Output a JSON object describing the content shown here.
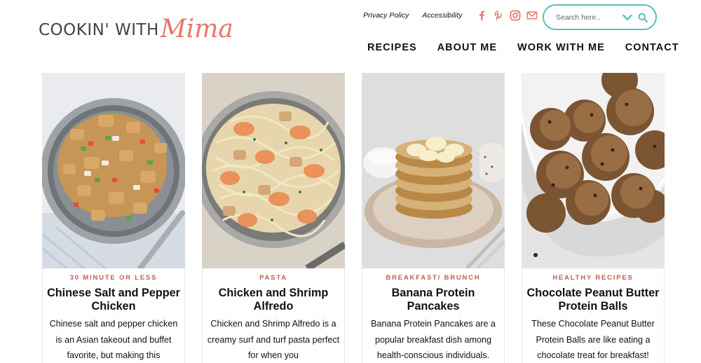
{
  "logo": {
    "text": "COOKIN' WITH",
    "script": "Mima"
  },
  "utility_links": {
    "privacy": "Privacy Policy",
    "accessibility": "Accessibility"
  },
  "social": [
    "facebook-icon",
    "pinterest-icon",
    "instagram-icon",
    "email-icon"
  ],
  "search": {
    "placeholder": "Search here.."
  },
  "nav": {
    "recipes": "RECIPES",
    "about": "ABOUT ME",
    "work": "WORK WITH ME",
    "contact": "CONTACT"
  },
  "colors": {
    "accent_teal": "#5bbfb9",
    "brand_coral": "#e8766b",
    "category_red": "#c45a4f"
  },
  "cards": [
    {
      "category": "30 MINUTE OR LESS",
      "title": "Chinese Salt and Pepper Chicken",
      "description": "Chinese salt and pepper chicken is an Asian takeout and buffet favorite, but making this"
    },
    {
      "category": "PASTA",
      "title": "Chicken and Shrimp Alfredo",
      "description": "Chicken and Shrimp Alfredo is a creamy surf and turf pasta perfect for when you"
    },
    {
      "category": "BREAKFAST/ BRUNCH",
      "title": "Banana Protein Pancakes",
      "description": "Banana Protein Pancakes are a popular breakfast dish among health-conscious individuals. These easy protein pancakes"
    },
    {
      "category": "HEALTHY RECIPES",
      "title": "Chocolate Peanut Butter Protein Balls",
      "description": "These Chocolate Peanut Butter Protein Balls are like eating a chocolate treat for breakfast!"
    }
  ]
}
